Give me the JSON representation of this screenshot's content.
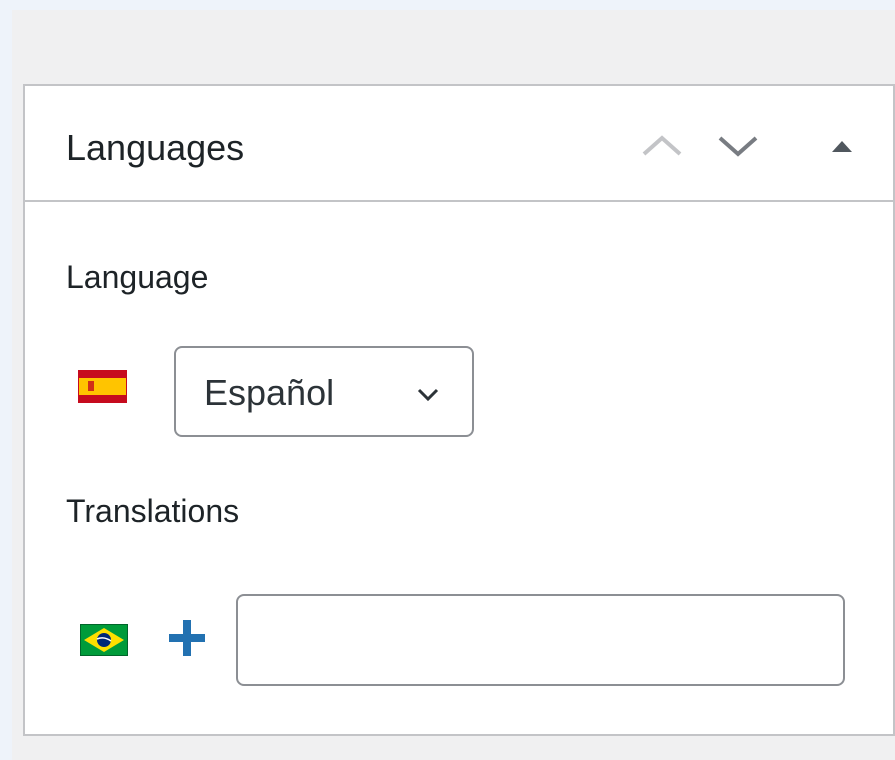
{
  "panel": {
    "title": "Languages",
    "buttons": {
      "move_up_icon": "chevron-up-icon",
      "move_down_icon": "chevron-down-icon",
      "toggle_icon": "triangle-up-icon"
    }
  },
  "language": {
    "label": "Language",
    "flag": "spain-flag-icon",
    "selected": "Español"
  },
  "translations": {
    "label": "Translations",
    "items": [
      {
        "flag": "brazil-flag-icon",
        "add_icon": "plus-icon",
        "value": ""
      }
    ]
  },
  "colors": {
    "accent": "#2271b1",
    "border": "#c3c4c7",
    "text": "#1d2327"
  }
}
